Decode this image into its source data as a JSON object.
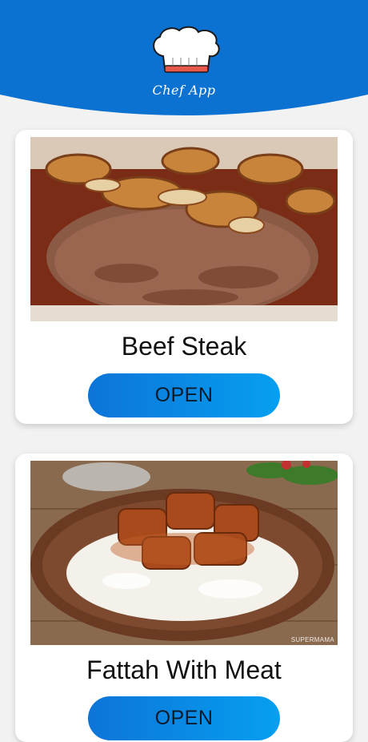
{
  "header": {
    "app_title": "Chef App",
    "logo_icon": "chef-hat-icon",
    "background_color": "#0b72d2"
  },
  "recipes": [
    {
      "title": "Beef Steak",
      "button_label": "OPEN"
    },
    {
      "title": "Fattah With Meat",
      "button_label": "OPEN",
      "image_watermark": "SUPERMAMA"
    }
  ],
  "colors": {
    "button_gradient_start": "#0d74d8",
    "button_gradient_end": "#069ff0",
    "page_background": "#f2f2f2",
    "card_background": "#ffffff"
  }
}
